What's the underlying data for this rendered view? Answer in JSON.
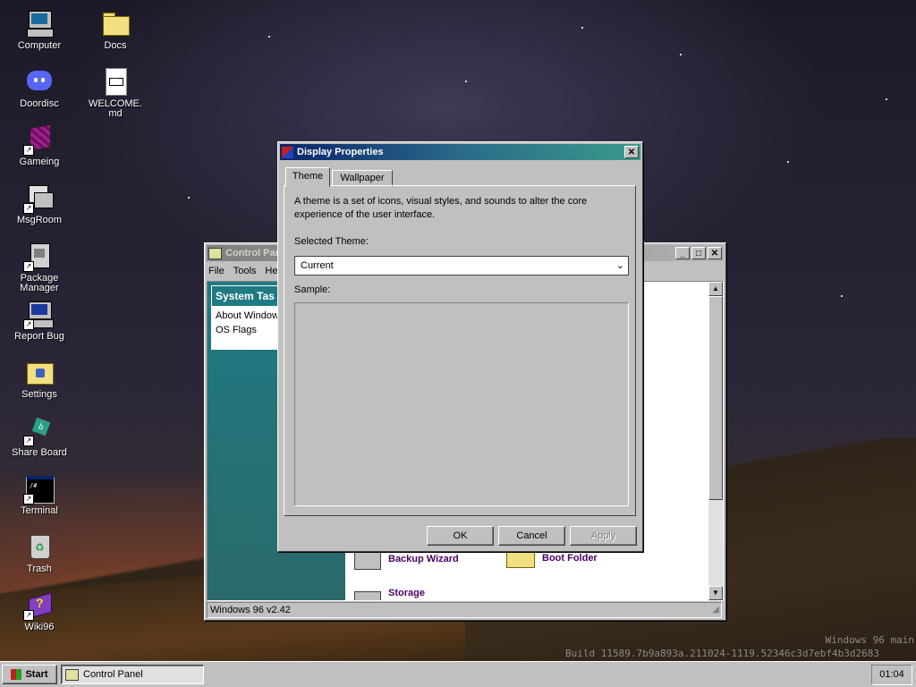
{
  "desktop": {
    "icons": [
      {
        "label": "Computer"
      },
      {
        "label": "Docs"
      },
      {
        "label": "Doordisc"
      },
      {
        "label": "WELCOME.md"
      },
      {
        "label": "Gameing"
      },
      {
        "label": "MsgRoom"
      },
      {
        "label": "Package Manager"
      },
      {
        "label": "Report Bug"
      },
      {
        "label": "Settings"
      },
      {
        "label": "Share Board"
      },
      {
        "label": "Terminal"
      },
      {
        "label": "Trash"
      },
      {
        "label": "Wiki96"
      }
    ],
    "watermark": {
      "line1": "Windows 96 main",
      "line2": "Build 11589.7b9a893a.211024-1119.52346c3d7ebf4b3d2683"
    }
  },
  "control_panel": {
    "title": "Control Panel",
    "menu": [
      "File",
      "Tools",
      "He"
    ],
    "sidebar_title": "System Tas",
    "sidebar_links": [
      "About Window",
      "OS Flags"
    ],
    "items": [
      {
        "label": "Backup Wizard"
      },
      {
        "label": "Boot Folder"
      },
      {
        "label": "Storage"
      }
    ],
    "status": "Windows 96 v2.42"
  },
  "display_properties": {
    "title": "Display Properties",
    "tabs": [
      {
        "label": "Theme"
      },
      {
        "label": "Wallpaper"
      }
    ],
    "description": "A theme is a set of icons, visual styles, and sounds to alter the core experience of the user interface.",
    "selected_theme_label": "Selected Theme:",
    "selected_theme_value": "Current",
    "sample_label": "Sample:",
    "buttons": {
      "ok": "OK",
      "cancel": "Cancel",
      "apply": "Apply"
    }
  },
  "taskbar": {
    "start": "Start",
    "task": "Control Panel",
    "clock": "01:04"
  },
  "colors": {
    "title_active_start": "#0a246a",
    "title_active_end": "#3a9a8a",
    "sidebar_teal": "#1f7a84",
    "link_purple": "#4a0066"
  }
}
